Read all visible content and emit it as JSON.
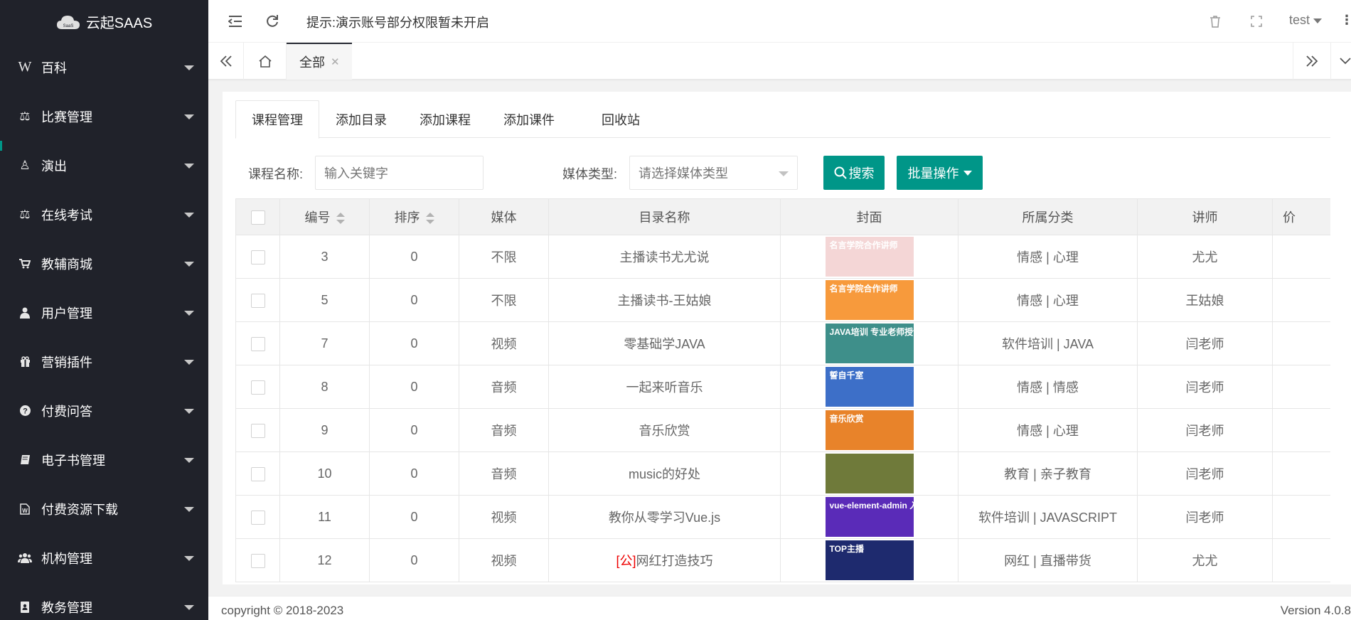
{
  "app": {
    "title": "云起SAAS",
    "logo_badge": "SaaS"
  },
  "sidebar": {
    "items": [
      {
        "label": "百科",
        "icon": "wikipedia-icon"
      },
      {
        "label": "比赛管理",
        "icon": "balance-scale-icon"
      },
      {
        "label": "演出",
        "icon": "performance-icon"
      },
      {
        "label": "在线考试",
        "icon": "balance-scale-icon"
      },
      {
        "label": "教辅商城",
        "icon": "cart-icon"
      },
      {
        "label": "用户管理",
        "icon": "user-icon"
      },
      {
        "label": "营销插件",
        "icon": "gift-icon"
      },
      {
        "label": "付费问答",
        "icon": "question-circle-icon"
      },
      {
        "label": "电子书管理",
        "icon": "book-icon"
      },
      {
        "label": "付费资源下载",
        "icon": "word-file-icon"
      },
      {
        "label": "机构管理",
        "icon": "users-icon"
      },
      {
        "label": "教务管理",
        "icon": "address-book-icon"
      }
    ]
  },
  "header": {
    "notice": "提示:演示账号部分权限暂未开启",
    "user": "test"
  },
  "tabbar": {
    "current_tab": "全部"
  },
  "inner_tabs": [
    "课程管理",
    "添加目录",
    "添加课程",
    "添加课件",
    "回收站"
  ],
  "filters": {
    "name_label": "课程名称:",
    "name_placeholder": "输入关键字",
    "media_label": "媒体类型:",
    "media_placeholder": "请选择媒体类型",
    "search_label": "搜索",
    "batch_label": "批量操作"
  },
  "table": {
    "headers": [
      "编号",
      "排序",
      "媒体",
      "目录名称",
      "封面",
      "所属分类",
      "讲师",
      "价"
    ],
    "rows": [
      {
        "id": "3",
        "sort": "0",
        "media": "不限",
        "name_prefix": "",
        "name": "主播读书尤尤说",
        "category": "情感 | 心理",
        "teacher": "尤尤",
        "cover_text": "名言学院合作讲师",
        "cover_color": "#f4d6d6"
      },
      {
        "id": "5",
        "sort": "0",
        "media": "不限",
        "name_prefix": "",
        "name": "主播读书-王姑娘",
        "category": "情感 | 心理",
        "teacher": "王姑娘",
        "cover_text": "名言学院合作讲师",
        "cover_color": "#f79a3c"
      },
      {
        "id": "7",
        "sort": "0",
        "media": "视频",
        "name_prefix": "",
        "name": "零基础学JAVA",
        "category": "软件培训 | JAVA",
        "teacher": "闫老师",
        "cover_text": "JAVA培训 专业老师授课",
        "cover_color": "#3e8f8a"
      },
      {
        "id": "8",
        "sort": "0",
        "media": "音频",
        "name_prefix": "",
        "name": "一起来听音乐",
        "category": "情感 | 情感",
        "teacher": "闫老师",
        "cover_text": "誓自千室",
        "cover_color": "#3d6fc8"
      },
      {
        "id": "9",
        "sort": "0",
        "media": "音频",
        "name_prefix": "",
        "name": "音乐欣赏",
        "category": "情感 | 心理",
        "teacher": "闫老师",
        "cover_text": "音乐欣赏",
        "cover_color": "#e8832a"
      },
      {
        "id": "10",
        "sort": "0",
        "media": "音频",
        "name_prefix": "",
        "name": "music的好处",
        "category": "教育 | 亲子教育",
        "teacher": "闫老师",
        "cover_text": "",
        "cover_color": "#6f7a3a"
      },
      {
        "id": "11",
        "sort": "0",
        "media": "视频",
        "name_prefix": "",
        "name": "教你从零学习Vue.js",
        "category": "软件培训 | JAVASCRIPT",
        "teacher": "闫老师",
        "cover_text": "vue-element-admin 入门+实战+API开发",
        "cover_color": "#5a2bb8"
      },
      {
        "id": "12",
        "sort": "0",
        "media": "视频",
        "name_prefix": "[公]",
        "name": "网红打造技巧",
        "category": "网红 | 直播带货",
        "teacher": "尤尤",
        "cover_text": "TOP主播",
        "cover_color": "#1e2a6e"
      }
    ]
  },
  "footer": {
    "copyright": "copyright © 2018-2023",
    "version": "Version 4.0.8"
  },
  "colors": {
    "sidebar_bg": "#20222a",
    "accent": "#009688"
  }
}
